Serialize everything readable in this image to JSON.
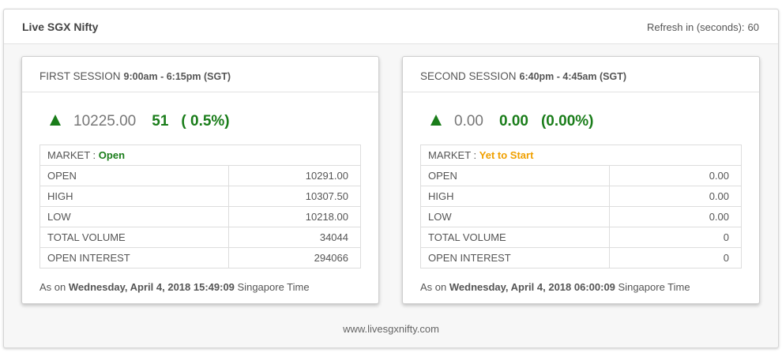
{
  "header": {
    "title": "Live SGX Nifty",
    "refresh_label": "Refresh in (seconds):",
    "refresh_value": "60"
  },
  "sessions": [
    {
      "title": "FIRST SESSION",
      "time": "9:00am - 6:15pm (SGT)",
      "direction": "up",
      "price": "10225.00",
      "change": "51",
      "percent": "( 0.5%)",
      "market_label": "MARKET :",
      "market_status": "Open",
      "rows": [
        {
          "label": "OPEN",
          "value": "10291.00"
        },
        {
          "label": "HIGH",
          "value": "10307.50"
        },
        {
          "label": "LOW",
          "value": "10218.00"
        },
        {
          "label": "TOTAL VOLUME",
          "value": "34044"
        },
        {
          "label": "OPEN INTEREST",
          "value": "294066"
        }
      ],
      "as_on_prefix": "As on",
      "as_on_datetime": "Wednesday, April 4, 2018 15:49:09",
      "as_on_suffix": "Singapore Time"
    },
    {
      "title": "SECOND SESSION",
      "time": "6:40pm - 4:45am (SGT)",
      "direction": "up",
      "price": "0.00",
      "change": "0.00",
      "percent": "(0.00%)",
      "market_label": "MARKET :",
      "market_status": "Yet to Start",
      "rows": [
        {
          "label": "OPEN",
          "value": "0.00"
        },
        {
          "label": "HIGH",
          "value": "0.00"
        },
        {
          "label": "LOW",
          "value": "0.00"
        },
        {
          "label": "TOTAL VOLUME",
          "value": "0"
        },
        {
          "label": "OPEN INTEREST",
          "value": "0"
        }
      ],
      "as_on_prefix": "As on",
      "as_on_datetime": "Wednesday, April 4, 2018 06:00:09",
      "as_on_suffix": "Singapore Time"
    }
  ],
  "colors": {
    "up": "#1a7d1a",
    "market_open": "#1a7d1a",
    "market_waiting": "#f0a000"
  },
  "footer": {
    "url": "www.livesgxnifty.com"
  }
}
